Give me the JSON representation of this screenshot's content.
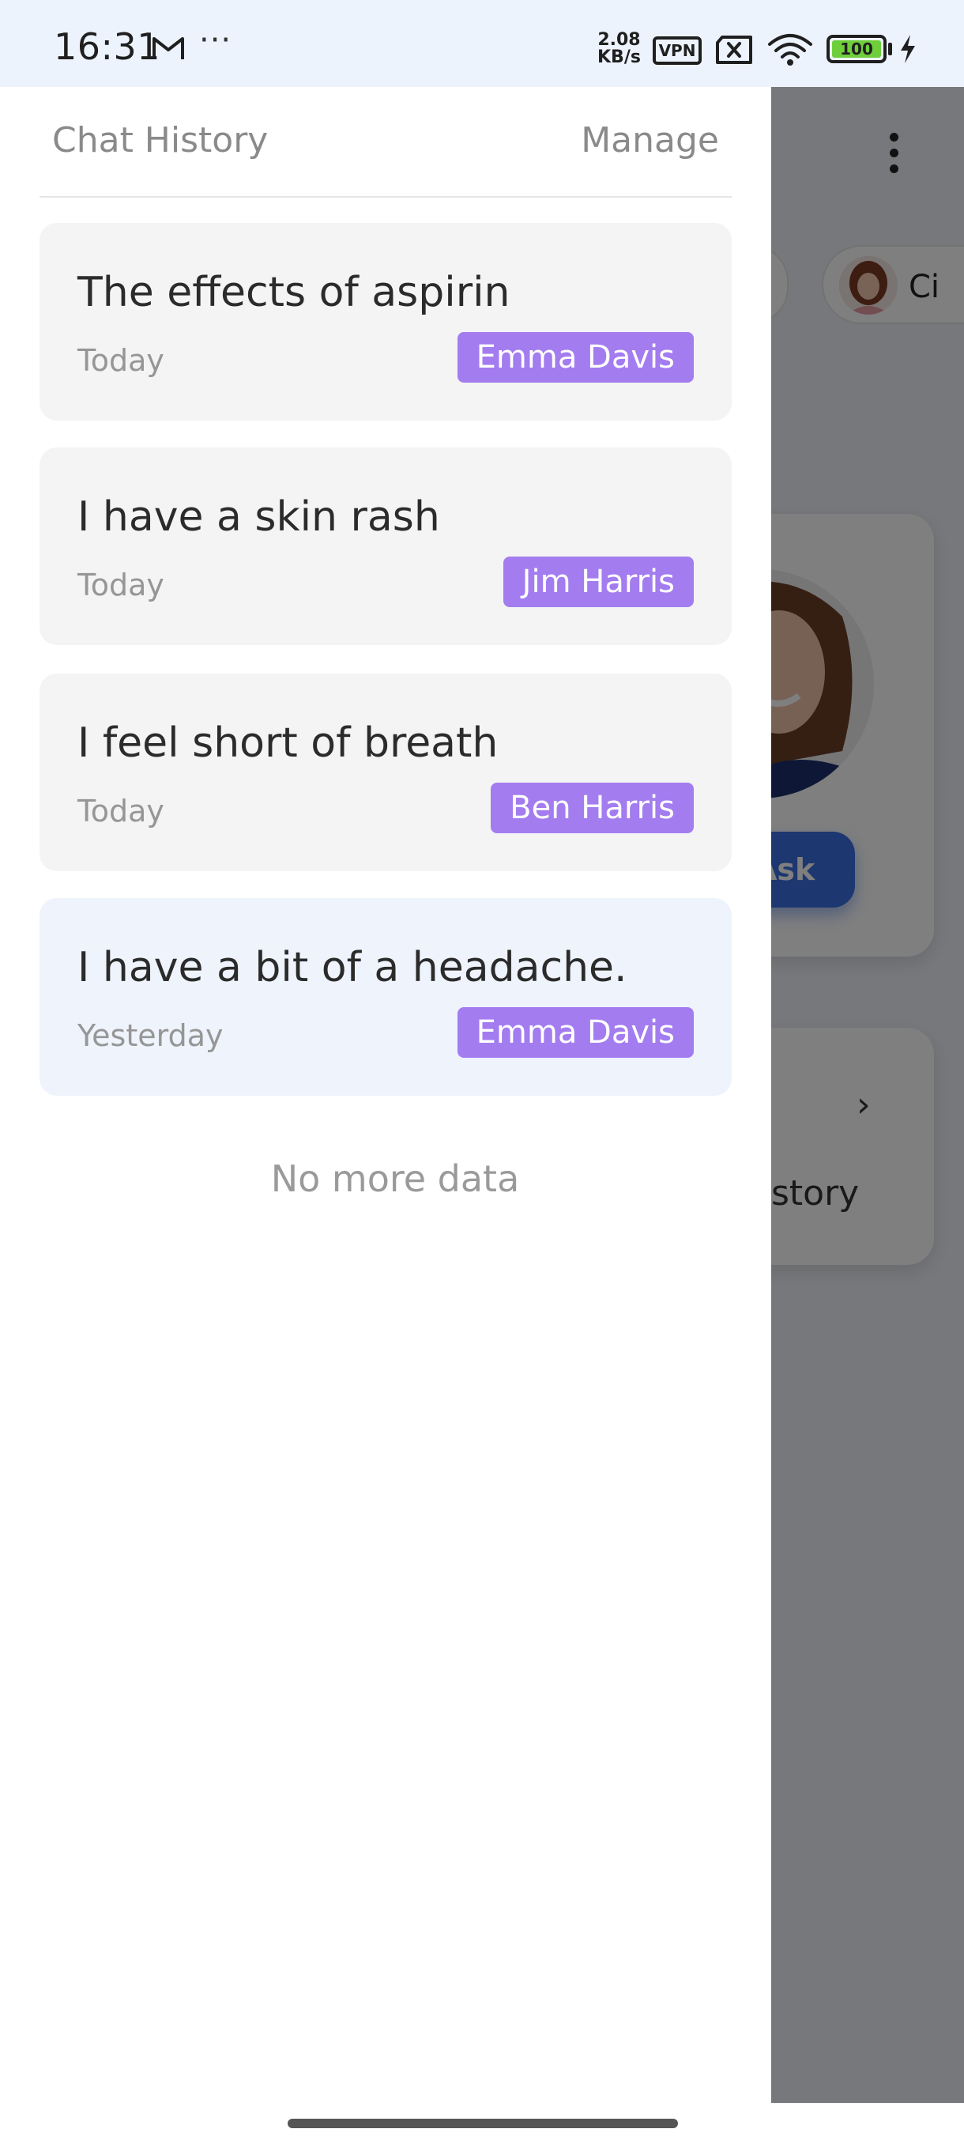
{
  "status_bar": {
    "time": "16:31",
    "speed_value": "2.08",
    "speed_unit": "KB/s",
    "vpn_label": "VPN",
    "battery_level": "100",
    "icons": [
      "gmail-icon",
      "more-dots-icon",
      "vpn-icon",
      "no-sim-icon",
      "wifi-icon",
      "battery-icon",
      "charging-icon"
    ]
  },
  "drawer": {
    "title": "Chat History",
    "manage_label": "Manage",
    "chats": [
      {
        "title": "The effects of aspirin",
        "date": "Today",
        "doctor": "Emma Davis"
      },
      {
        "title": "I have a skin rash",
        "date": "Today",
        "doctor": "Jim Harris"
      },
      {
        "title": "I feel short of breath",
        "date": "Today",
        "doctor": "Ben Harris"
      },
      {
        "title": "I have a bit of a headache.",
        "date": "Yesterday",
        "doctor": "Emma Davis"
      }
    ],
    "footer": "No more data"
  },
  "background_app": {
    "chip_label": "Ci",
    "ask_label": "Ask",
    "history_fragment": "story"
  },
  "colors": {
    "status_bar_bg": "#edf3fd",
    "tag_purple": "#a37cf0",
    "card_bg": "#f4f4f4",
    "active_card_bg": "#eef3fc",
    "ask_blue": "#3a6fe0",
    "battery_green": "#6fcf3b"
  }
}
